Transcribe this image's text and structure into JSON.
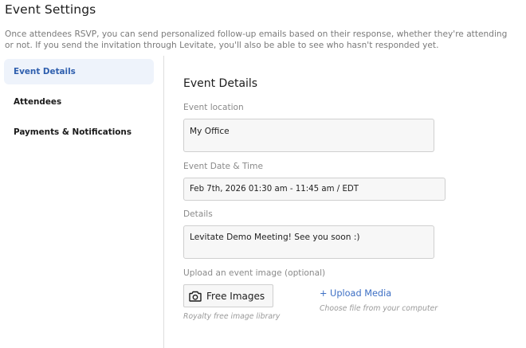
{
  "header": {
    "title": "Event Settings",
    "description": "Once attendees RSVP, you can send personalized follow-up emails based on their response, whether they're attending or not. If you send the invitation through Levitate, you'll also be able to see who hasn't responded yet."
  },
  "sidebar": {
    "items": [
      {
        "label": "Event Details",
        "active": true
      },
      {
        "label": "Attendees",
        "active": false
      },
      {
        "label": "Payments & Notifications",
        "active": false
      }
    ]
  },
  "main": {
    "section_title": "Event Details",
    "location": {
      "label": "Event location",
      "value": "My Office"
    },
    "date_time": {
      "label": "Event Date & Time",
      "value": "Feb 7th, 2026 01:30 am - 11:45 am / EDT"
    },
    "details": {
      "label": "Details",
      "value": "Levitate Demo Meeting! See you soon :)"
    },
    "upload": {
      "label": "Upload an event image (optional)",
      "free_images_label": "Free Images",
      "free_images_icon": "camera-icon",
      "free_images_hint": "Royalty free image library",
      "upload_media_label": "+ Upload Media",
      "upload_media_hint": "Choose file from your computer"
    }
  },
  "colors": {
    "accent": "#3d6fc4",
    "active_bg": "#eef3fb",
    "active_text": "#2f5fae"
  }
}
